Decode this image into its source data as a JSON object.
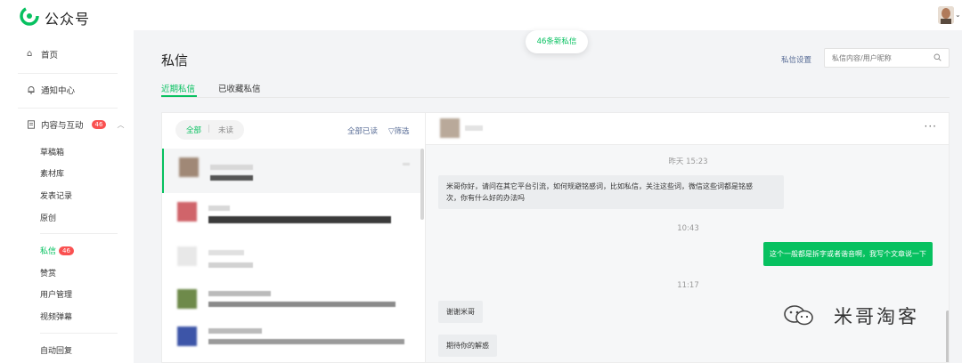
{
  "app": {
    "brand": "公众号"
  },
  "sidebar": {
    "home": "首页",
    "notifications": "通知中心",
    "content": {
      "label": "内容与互动",
      "badge": "46"
    },
    "content_items": [
      "草稿箱",
      "素材库",
      "发表记录",
      "原创"
    ],
    "messages": {
      "label": "私信",
      "badge": "46"
    },
    "more_items": [
      "赞赏",
      "用户管理",
      "视频弹幕"
    ],
    "auto_reply": "自动回复"
  },
  "page": {
    "title": "私信",
    "tabs": [
      "近期私信",
      "已收藏私信"
    ],
    "settings_link": "私信设置",
    "search_placeholder": "私信内容/用户昵称",
    "new_pill": "46条新私信"
  },
  "list": {
    "filter_all": "全部",
    "filter_sep": "|",
    "filter_unread": "未读",
    "mark_all_read": "全部已读",
    "filter": "筛选",
    "item_count": 5
  },
  "chat": {
    "more": "···",
    "messages": [
      {
        "time": "昨天 15:23",
        "direction": "in",
        "text": "米哥你好，请问在其它平台引流，如何规避铭感词，比如私信，关注这些词，微信这些词都是铭感\n次，你有什么好的办法吗"
      },
      {
        "time": "10:43",
        "direction": "out",
        "text": "这个一般都是拆字或者谐音啊，我写个文章说一下"
      },
      {
        "time": "11:17",
        "direction": "in",
        "text": "谢谢米哥"
      },
      {
        "time": "",
        "direction": "in",
        "text": "期待你的解惑"
      }
    ]
  },
  "watermark": "米哥淘客",
  "colors": {
    "accent": "#07c160",
    "link": "#576b95",
    "badge": "#fa5151"
  }
}
